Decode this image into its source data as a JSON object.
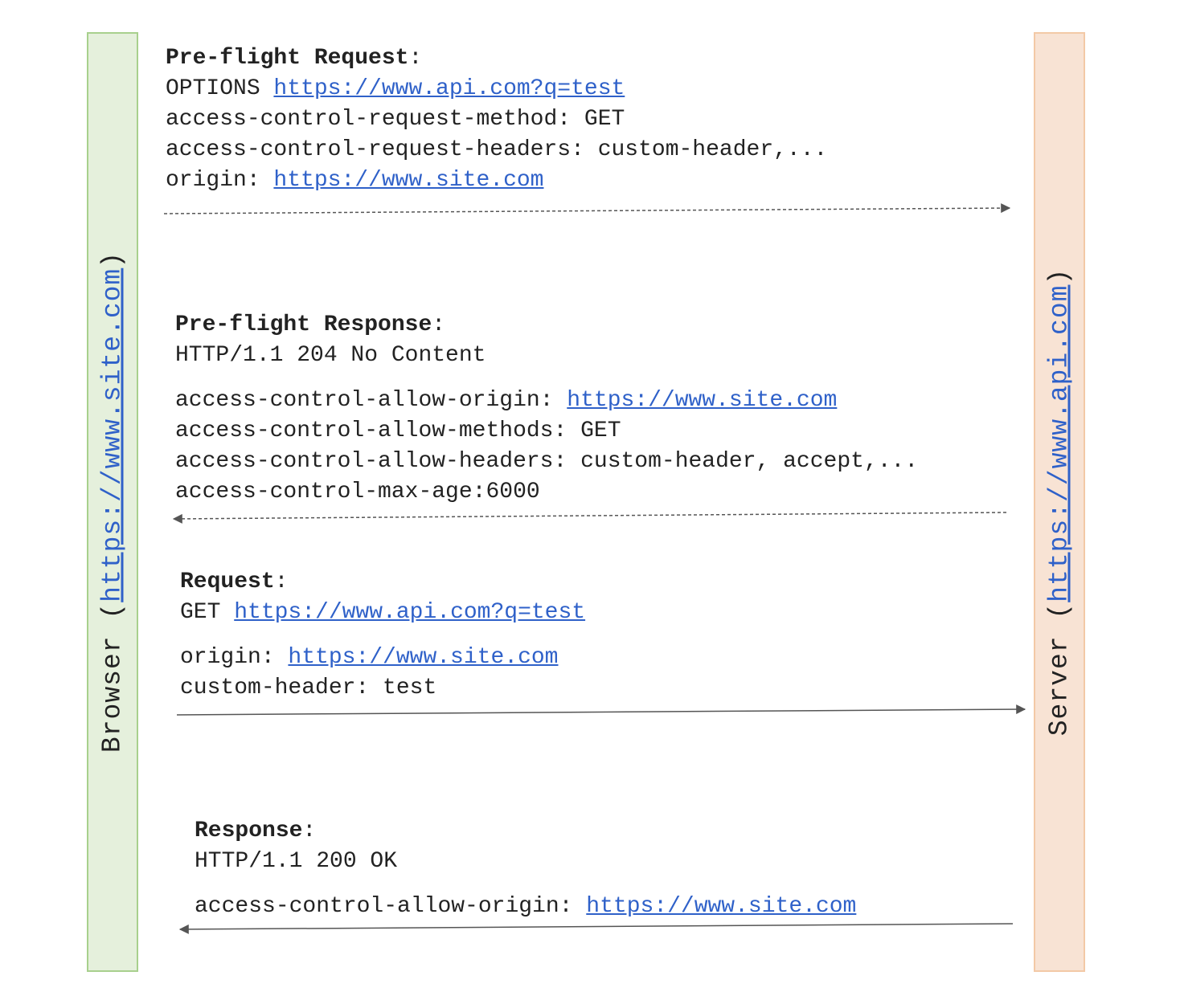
{
  "browser": {
    "label_prefix": "Browser (",
    "label_link": "https://www.site.com",
    "label_suffix": ")",
    "fill": "#e5f0dc",
    "border": "#a8d08d"
  },
  "server": {
    "label_prefix": "Server (",
    "label_link": "https://www.api.com",
    "label_suffix": ")",
    "fill": "#f8e3d4",
    "border": "#f3c9a6"
  },
  "preflight_request": {
    "title": "Pre-flight Request",
    "colon": ":",
    "method": "OPTIONS ",
    "url": "https://www.api.com?q=test",
    "header_method": "access-control-request-method: GET",
    "header_headers": "access-control-request-headers: custom-header,...",
    "origin_key": "origin: ",
    "origin_value": "https://www.site.com"
  },
  "preflight_response": {
    "title": "Pre-flight Response",
    "colon": ":",
    "status": "HTTP/1.1 204 No Content",
    "allow_origin_key": "access-control-allow-origin: ",
    "allow_origin_value": "https://www.site.com",
    "allow_methods": "access-control-allow-methods: GET",
    "allow_headers": "access-control-allow-headers: custom-header, accept,...",
    "max_age": "access-control-max-age:6000"
  },
  "request": {
    "title": "Request",
    "colon": ":",
    "method": "GET ",
    "url": "https://www.api.com?q=test",
    "origin_key": "origin: ",
    "origin_value": "https://www.site.com",
    "custom_header": "custom-header: test"
  },
  "response": {
    "title": "Response",
    "colon": ":",
    "status": "HTTP/1.1 200 OK",
    "allow_origin_key": "access-control-allow-origin: ",
    "allow_origin_value": "https://www.site.com"
  },
  "colors": {
    "link": "#2f61c9",
    "arrow": "#555555"
  }
}
